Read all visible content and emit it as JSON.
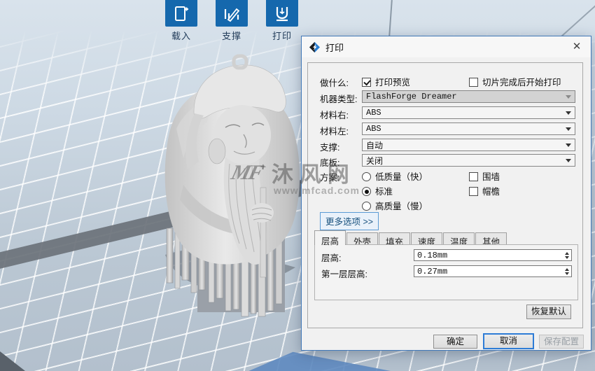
{
  "toolbar": {
    "items": [
      {
        "label": "载入",
        "icon": "load-document-plus-icon"
      },
      {
        "label": "支撑",
        "icon": "support-pencil-icon"
      },
      {
        "label": "打印",
        "icon": "print-extruder-icon"
      }
    ],
    "accent_color": "#1568ad"
  },
  "viewport": {
    "grid_color": "#ffffff",
    "plate_edge_dark_color": "#6b727a",
    "plate_edge_blue_color": "#5e8ac0",
    "model": "sage-statue-with-supports"
  },
  "watermark": {
    "logo": "MF",
    "plus": "+",
    "text": "沐风网",
    "url": "www.mfcad.com"
  },
  "dialog": {
    "title": "打印",
    "icons": {
      "close": "✕",
      "app_logo": "flashprint-diamond"
    },
    "what": {
      "label": "做什么:"
    },
    "checkbox_preview": {
      "label": "打印预览",
      "checked": true
    },
    "checkbox_start_after_slice": {
      "label": "切片完成后开始打印",
      "checked": false
    },
    "machine_type": {
      "label": "机器类型:",
      "value": "FlashForge Dreamer"
    },
    "material_right": {
      "label": "材料右:",
      "value": "ABS"
    },
    "material_left": {
      "label": "材料左:",
      "value": "ABS"
    },
    "supports": {
      "label": "支撑:",
      "value": "自动"
    },
    "raft": {
      "label": "底板:",
      "value": "关闭"
    },
    "scheme": {
      "label": "方案:",
      "options": [
        {
          "label": "低质量（快）",
          "selected": false
        },
        {
          "label": "标准",
          "selected": true
        },
        {
          "label": "高质量（慢）",
          "selected": false
        }
      ]
    },
    "wall": {
      "label": "围墙",
      "checked": false
    },
    "brim": {
      "label": "帽檐",
      "checked": false
    },
    "more_options_label": "更多选项 >>",
    "tabs": [
      "层高",
      "外壳",
      "填充",
      "速度",
      "温度",
      "其他"
    ],
    "active_tab": "层高",
    "layer_height": {
      "label": "层高:",
      "value": "0.18mm"
    },
    "first_layer_height": {
      "label": "第一层层高:",
      "value": "0.27mm"
    },
    "restore_defaults_label": "恢复默认",
    "ok_label": "确定",
    "cancel_label": "取消",
    "save_config_label": "保存配置",
    "save_config_enabled": false
  }
}
